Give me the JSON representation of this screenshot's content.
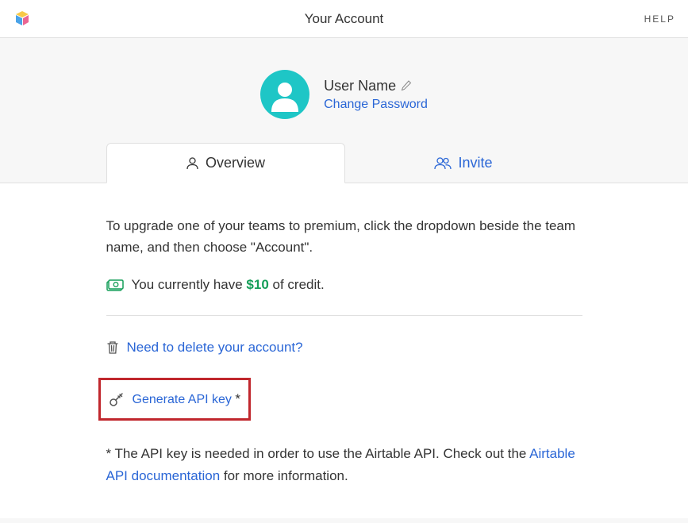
{
  "header": {
    "title": "Your Account",
    "help": "HELP"
  },
  "profile": {
    "user_name": "User Name",
    "change_password": "Change Password"
  },
  "tabs": {
    "overview": "Overview",
    "invite": "Invite"
  },
  "content": {
    "upgrade_text": "To upgrade one of your teams to premium, click the dropdown beside the team name, and then choose \"Account\".",
    "credit_prefix": "You currently have ",
    "credit_amount": "$10",
    "credit_suffix": " of credit.",
    "delete_account": "Need to delete your account?",
    "generate_api": "Generate API key",
    "footer_prefix": "* The API key is needed in order to use the Airtable API. Check out the ",
    "footer_link": "Airtable API documentation",
    "footer_suffix": " for more information."
  }
}
